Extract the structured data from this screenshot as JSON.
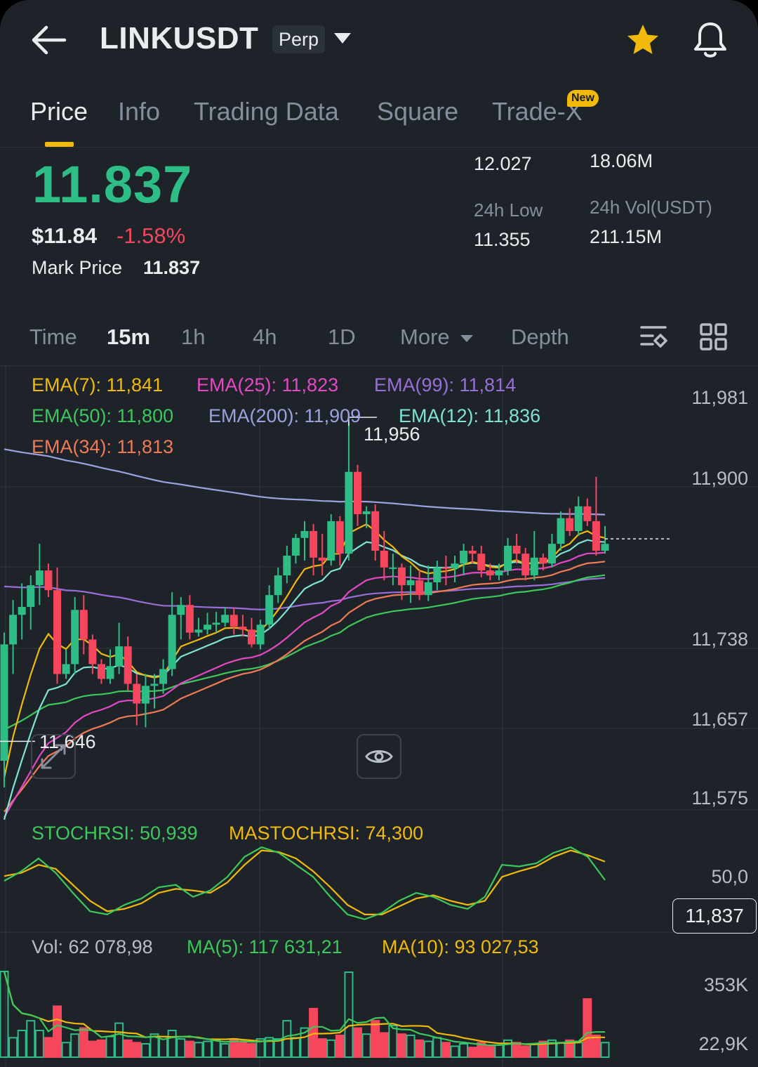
{
  "header": {
    "symbol": "LINKUSDT",
    "contract_type": "Perp"
  },
  "tabs": [
    {
      "label": "Price",
      "active": true
    },
    {
      "label": "Info",
      "active": false
    },
    {
      "label": "Trading Data",
      "active": false
    },
    {
      "label": "Square",
      "active": false
    },
    {
      "label": "Trade-X",
      "active": false,
      "badge": "New"
    }
  ],
  "price": {
    "last": "11.837",
    "usd": "$11.84",
    "change": "-1.58%",
    "mark_label": "Mark Price",
    "mark_value": "11.837"
  },
  "stats": {
    "high_value": "12.027",
    "low_label": "24h Low",
    "low_value": "11.355",
    "vol_coin_value": "18.06M",
    "vol_usdt_label": "24h Vol(USDT)",
    "vol_usdt_value": "211.15M"
  },
  "intervals": [
    {
      "label": "Time",
      "active": false
    },
    {
      "label": "15m",
      "active": true
    },
    {
      "label": "1h",
      "active": false
    },
    {
      "label": "4h",
      "active": false
    },
    {
      "label": "1D",
      "active": false
    },
    {
      "label": "More",
      "active": false
    },
    {
      "label": "Depth",
      "active": false
    }
  ],
  "indicators": {
    "ema7": "EMA(7): 11,841",
    "ema25": "EMA(25): 11,823",
    "ema99": "EMA(99): 11,814",
    "ema50": "EMA(50): 11,800",
    "ema200": "EMA(200): 11,909",
    "ema12": "EMA(12): 11,836",
    "ema34": "EMA(34): 11,813"
  },
  "price_axis": [
    "11,981",
    "11,900",
    "11,738",
    "11,657",
    "11,575"
  ],
  "current_price_tag": "11,837",
  "high_marker": "11,956",
  "low_marker": "11,646",
  "stochrsi": {
    "label": "STOCHRSI: 50,939",
    "ma_label": "MASTOCHRSI: 74,300",
    "axis": "50,0"
  },
  "volume": {
    "vol_label": "Vol: 62 078,98",
    "ma5_label": "MA(5): 117 631,21",
    "ma10_label": "MA(10): 93 027,53",
    "axis_top": "353K",
    "axis_bottom": "22,9K"
  },
  "colors": {
    "up": "#2EBD85",
    "down": "#F6465D",
    "accent": "#F0B90B",
    "ema7": "#F0B90B",
    "ema25": "#E349C4",
    "ema99": "#9A6ED8",
    "ema50": "#3CC85A",
    "ema200": "#9AA3E0",
    "ema12": "#7FE3D5",
    "ema34": "#F07A55"
  },
  "chart_data": {
    "type": "candlestick",
    "interval": "15m",
    "candles": [
      [
        11.612,
        11.73,
        11.585,
        11.742
      ],
      [
        11.73,
        11.76,
        11.7,
        11.775
      ],
      [
        11.76,
        11.768,
        11.735,
        11.792
      ],
      [
        11.768,
        11.79,
        11.745,
        11.8
      ],
      [
        11.79,
        11.805,
        11.77,
        11.832
      ],
      [
        11.805,
        11.785,
        11.778,
        11.812
      ],
      [
        11.785,
        11.7,
        11.69,
        11.808
      ],
      [
        11.7,
        11.71,
        11.695,
        11.725
      ],
      [
        11.71,
        11.765,
        11.7,
        11.778
      ],
      [
        11.765,
        11.735,
        11.72,
        11.78
      ],
      [
        11.735,
        11.71,
        11.7,
        11.74
      ],
      [
        11.71,
        11.695,
        11.69,
        11.715
      ],
      [
        11.695,
        11.708,
        11.69,
        11.725
      ],
      [
        11.708,
        11.728,
        11.7,
        11.752
      ],
      [
        11.728,
        11.69,
        11.683,
        11.738
      ],
      [
        11.69,
        11.67,
        11.648,
        11.7
      ],
      [
        11.67,
        11.688,
        11.646,
        11.7
      ],
      [
        11.688,
        11.69,
        11.665,
        11.7
      ],
      [
        11.69,
        11.705,
        11.68,
        11.715
      ],
      [
        11.705,
        11.76,
        11.698,
        11.783
      ],
      [
        11.76,
        11.77,
        11.735,
        11.778
      ],
      [
        11.77,
        11.742,
        11.735,
        11.78
      ],
      [
        11.742,
        11.745,
        11.738,
        11.757
      ],
      [
        11.745,
        11.75,
        11.74,
        11.762
      ],
      [
        11.75,
        11.752,
        11.742,
        11.763
      ],
      [
        11.752,
        11.76,
        11.748,
        11.768
      ],
      [
        11.76,
        11.748,
        11.74,
        11.767
      ],
      [
        11.748,
        11.745,
        11.738,
        11.76
      ],
      [
        11.745,
        11.73,
        11.727,
        11.757
      ],
      [
        11.73,
        11.75,
        11.725,
        11.755
      ],
      [
        11.75,
        11.78,
        11.745,
        11.79
      ],
      [
        11.78,
        11.8,
        11.772,
        11.808
      ],
      [
        11.8,
        11.82,
        11.792,
        11.83
      ],
      [
        11.82,
        11.838,
        11.812,
        11.842
      ],
      [
        11.838,
        11.845,
        11.815,
        11.855
      ],
      [
        11.845,
        11.818,
        11.8,
        11.852
      ],
      [
        11.818,
        11.815,
        11.8,
        11.842
      ],
      [
        11.815,
        11.855,
        11.81,
        11.862
      ],
      [
        11.855,
        11.822,
        11.81,
        11.86
      ],
      [
        11.822,
        11.905,
        11.815,
        11.956
      ],
      [
        11.905,
        11.862,
        11.85,
        11.912
      ],
      [
        11.862,
        11.865,
        11.848,
        11.87
      ],
      [
        11.865,
        11.825,
        11.815,
        11.872
      ],
      [
        11.825,
        11.808,
        11.795,
        11.845
      ],
      [
        11.808,
        11.808,
        11.79,
        11.822
      ],
      [
        11.808,
        11.79,
        11.775,
        11.812
      ],
      [
        11.79,
        11.795,
        11.772,
        11.81
      ],
      [
        11.795,
        11.78,
        11.775,
        11.805
      ],
      [
        11.78,
        11.793,
        11.774,
        11.81
      ],
      [
        11.793,
        11.808,
        11.785,
        11.815
      ],
      [
        11.808,
        11.807,
        11.79,
        11.82
      ],
      [
        11.807,
        11.812,
        11.793,
        11.82
      ],
      [
        11.812,
        11.825,
        11.8,
        11.832
      ],
      [
        11.825,
        11.822,
        11.812,
        11.83
      ],
      [
        11.822,
        11.805,
        11.798,
        11.83
      ],
      [
        11.805,
        11.8,
        11.795,
        11.812
      ],
      [
        11.8,
        11.805,
        11.795,
        11.812
      ],
      [
        11.805,
        11.83,
        11.8,
        11.838
      ],
      [
        11.83,
        11.822,
        11.812,
        11.842
      ],
      [
        11.822,
        11.8,
        11.795,
        11.828
      ],
      [
        11.8,
        11.818,
        11.795,
        11.845
      ],
      [
        11.818,
        11.812,
        11.805,
        11.822
      ],
      [
        11.812,
        11.832,
        11.808,
        11.842
      ],
      [
        11.832,
        11.858,
        11.825,
        11.865
      ],
      [
        11.858,
        11.845,
        11.84,
        11.868
      ],
      [
        11.845,
        11.87,
        11.84,
        11.88
      ],
      [
        11.87,
        11.855,
        11.85,
        11.878
      ],
      [
        11.855,
        11.825,
        11.82,
        11.9
      ],
      [
        11.825,
        11.832,
        11.822,
        11.85
      ]
    ],
    "ema_lines": {
      "EMA(7)": 11.841,
      "EMA(25)": 11.823,
      "EMA(99)": 11.814,
      "EMA(50)": 11.8,
      "EMA(200)": 11.909,
      "EMA(12)": 11.836,
      "EMA(34)": 11.813
    },
    "price_axis": [
      11981,
      11900,
      11738,
      11657,
      11575
    ],
    "stochrsi": [
      50,
      62,
      78,
      60,
      35,
      12,
      8,
      20,
      28,
      42,
      45,
      30,
      38,
      55,
      80,
      92,
      85,
      70,
      55,
      30,
      8,
      2,
      10,
      25,
      35,
      30,
      20,
      15,
      30,
      70,
      68,
      72,
      85,
      92,
      80,
      51
    ],
    "mastochrsi": [
      56,
      60,
      70,
      65,
      45,
      25,
      12,
      15,
      22,
      35,
      40,
      38,
      35,
      48,
      70,
      88,
      86,
      78,
      62,
      42,
      20,
      8,
      8,
      18,
      28,
      32,
      25,
      20,
      25,
      55,
      62,
      68,
      80,
      88,
      82,
      74
    ],
    "volume": [
      353,
      80,
      110,
      150,
      110,
      80,
      210,
      60,
      95,
      120,
      65,
      70,
      85,
      140,
      70,
      60,
      55,
      95,
      85,
      110,
      75,
      65,
      60,
      65,
      70,
      55,
      75,
      60,
      55,
      75,
      80,
      75,
      150,
      80,
      120,
      200,
      75,
      70,
      90,
      350,
      120,
      95,
      150,
      100,
      130,
      95,
      90,
      70,
      65,
      80,
      60,
      45,
      55,
      40,
      60,
      45,
      50,
      70,
      60,
      45,
      55,
      65,
      70,
      60,
      70,
      60,
      240,
      90,
      60
    ],
    "volume_axis": [
      "353K",
      "22,9K"
    ]
  }
}
